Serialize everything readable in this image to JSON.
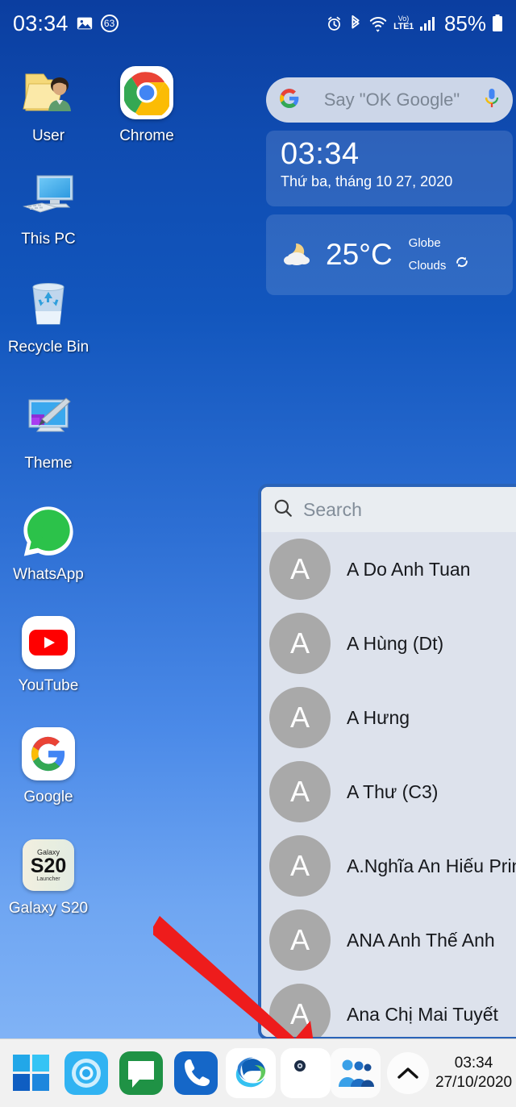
{
  "status_bar": {
    "time": "03:34",
    "notification_count": "63",
    "battery_percent": "85%",
    "volte_top": "Vo)",
    "volte_bottom": "LTE1",
    "icons": [
      "image-icon",
      "alarm-icon",
      "bluetooth-icon",
      "wifi-icon",
      "volte-icon",
      "signal-icon",
      "battery-icon"
    ]
  },
  "desktop_icons": [
    {
      "label": "User",
      "icon": "user-folder-icon"
    },
    {
      "label": "Chrome",
      "icon": "chrome-icon"
    },
    {
      "label": "This PC",
      "icon": "this-pc-icon"
    },
    {
      "label": "Recycle Bin",
      "icon": "recycle-bin-icon"
    },
    {
      "label": "Theme",
      "icon": "theme-icon"
    },
    {
      "label": "WhatsApp",
      "icon": "whatsapp-icon"
    },
    {
      "label": "YouTube",
      "icon": "youtube-icon"
    },
    {
      "label": "Google",
      "icon": "google-icon"
    },
    {
      "label": "Galaxy S20",
      "icon": "galaxy-s20-launcher-icon"
    }
  ],
  "galaxy_icon": {
    "top": "Galaxy",
    "mid": "S20",
    "bottom": "Launcher"
  },
  "google_search": {
    "placeholder": "Say \"OK Google\""
  },
  "clock_widget": {
    "time": "03:34",
    "date": "Thứ ba, tháng 10 27, 2020"
  },
  "weather_widget": {
    "temperature": "25°C",
    "location": "Globe",
    "condition": "Clouds",
    "weather_icon": "moon-cloud-icon",
    "refresh_icon": "refresh-icon"
  },
  "contacts_panel": {
    "search_placeholder": "Search",
    "contacts": [
      {
        "initial": "A",
        "name": "A Do Anh Tuan"
      },
      {
        "initial": "A",
        "name": "A Hùng (Dt)"
      },
      {
        "initial": "A",
        "name": "A Hưng"
      },
      {
        "initial": "A",
        "name": "A Thư (C3)"
      },
      {
        "initial": "A",
        "name": "A.Nghĩa An Hiếu Print"
      },
      {
        "initial": "A",
        "name": "ANA Anh Thế Anh"
      },
      {
        "initial": "A",
        "name": "Ana Chị Mai Tuyết"
      }
    ]
  },
  "taskbar": {
    "left_items": [
      {
        "name": "start-button",
        "icon": "windows-icon"
      },
      {
        "name": "cortana-button",
        "icon": "cortana-circle-icon"
      },
      {
        "name": "messages-button",
        "icon": "message-bubble-icon"
      },
      {
        "name": "phone-button",
        "icon": "phone-handset-icon"
      },
      {
        "name": "edge-button",
        "icon": "edge-icon"
      },
      {
        "name": "camera-button",
        "icon": "camera-lens-icon"
      }
    ],
    "people_icon": "people-icon",
    "show_hidden_icon": "chevron-up-icon",
    "clock_time": "03:34",
    "clock_date": "27/10/2020",
    "notification_icon": "notification-flag-icon"
  },
  "annotation": {
    "arrow": "red-arrow-pointing-to-people-icon",
    "color": "#ee1c1c"
  },
  "colors": {
    "wallpaper_top": "#0b3ea0",
    "wallpaper_bottom": "#8dbbf8",
    "panel_bg": "#dde2ec",
    "panel_border": "#2a63b8",
    "taskbar_bg": "#f1f1f1",
    "arrow_red": "#ee1c1c"
  }
}
